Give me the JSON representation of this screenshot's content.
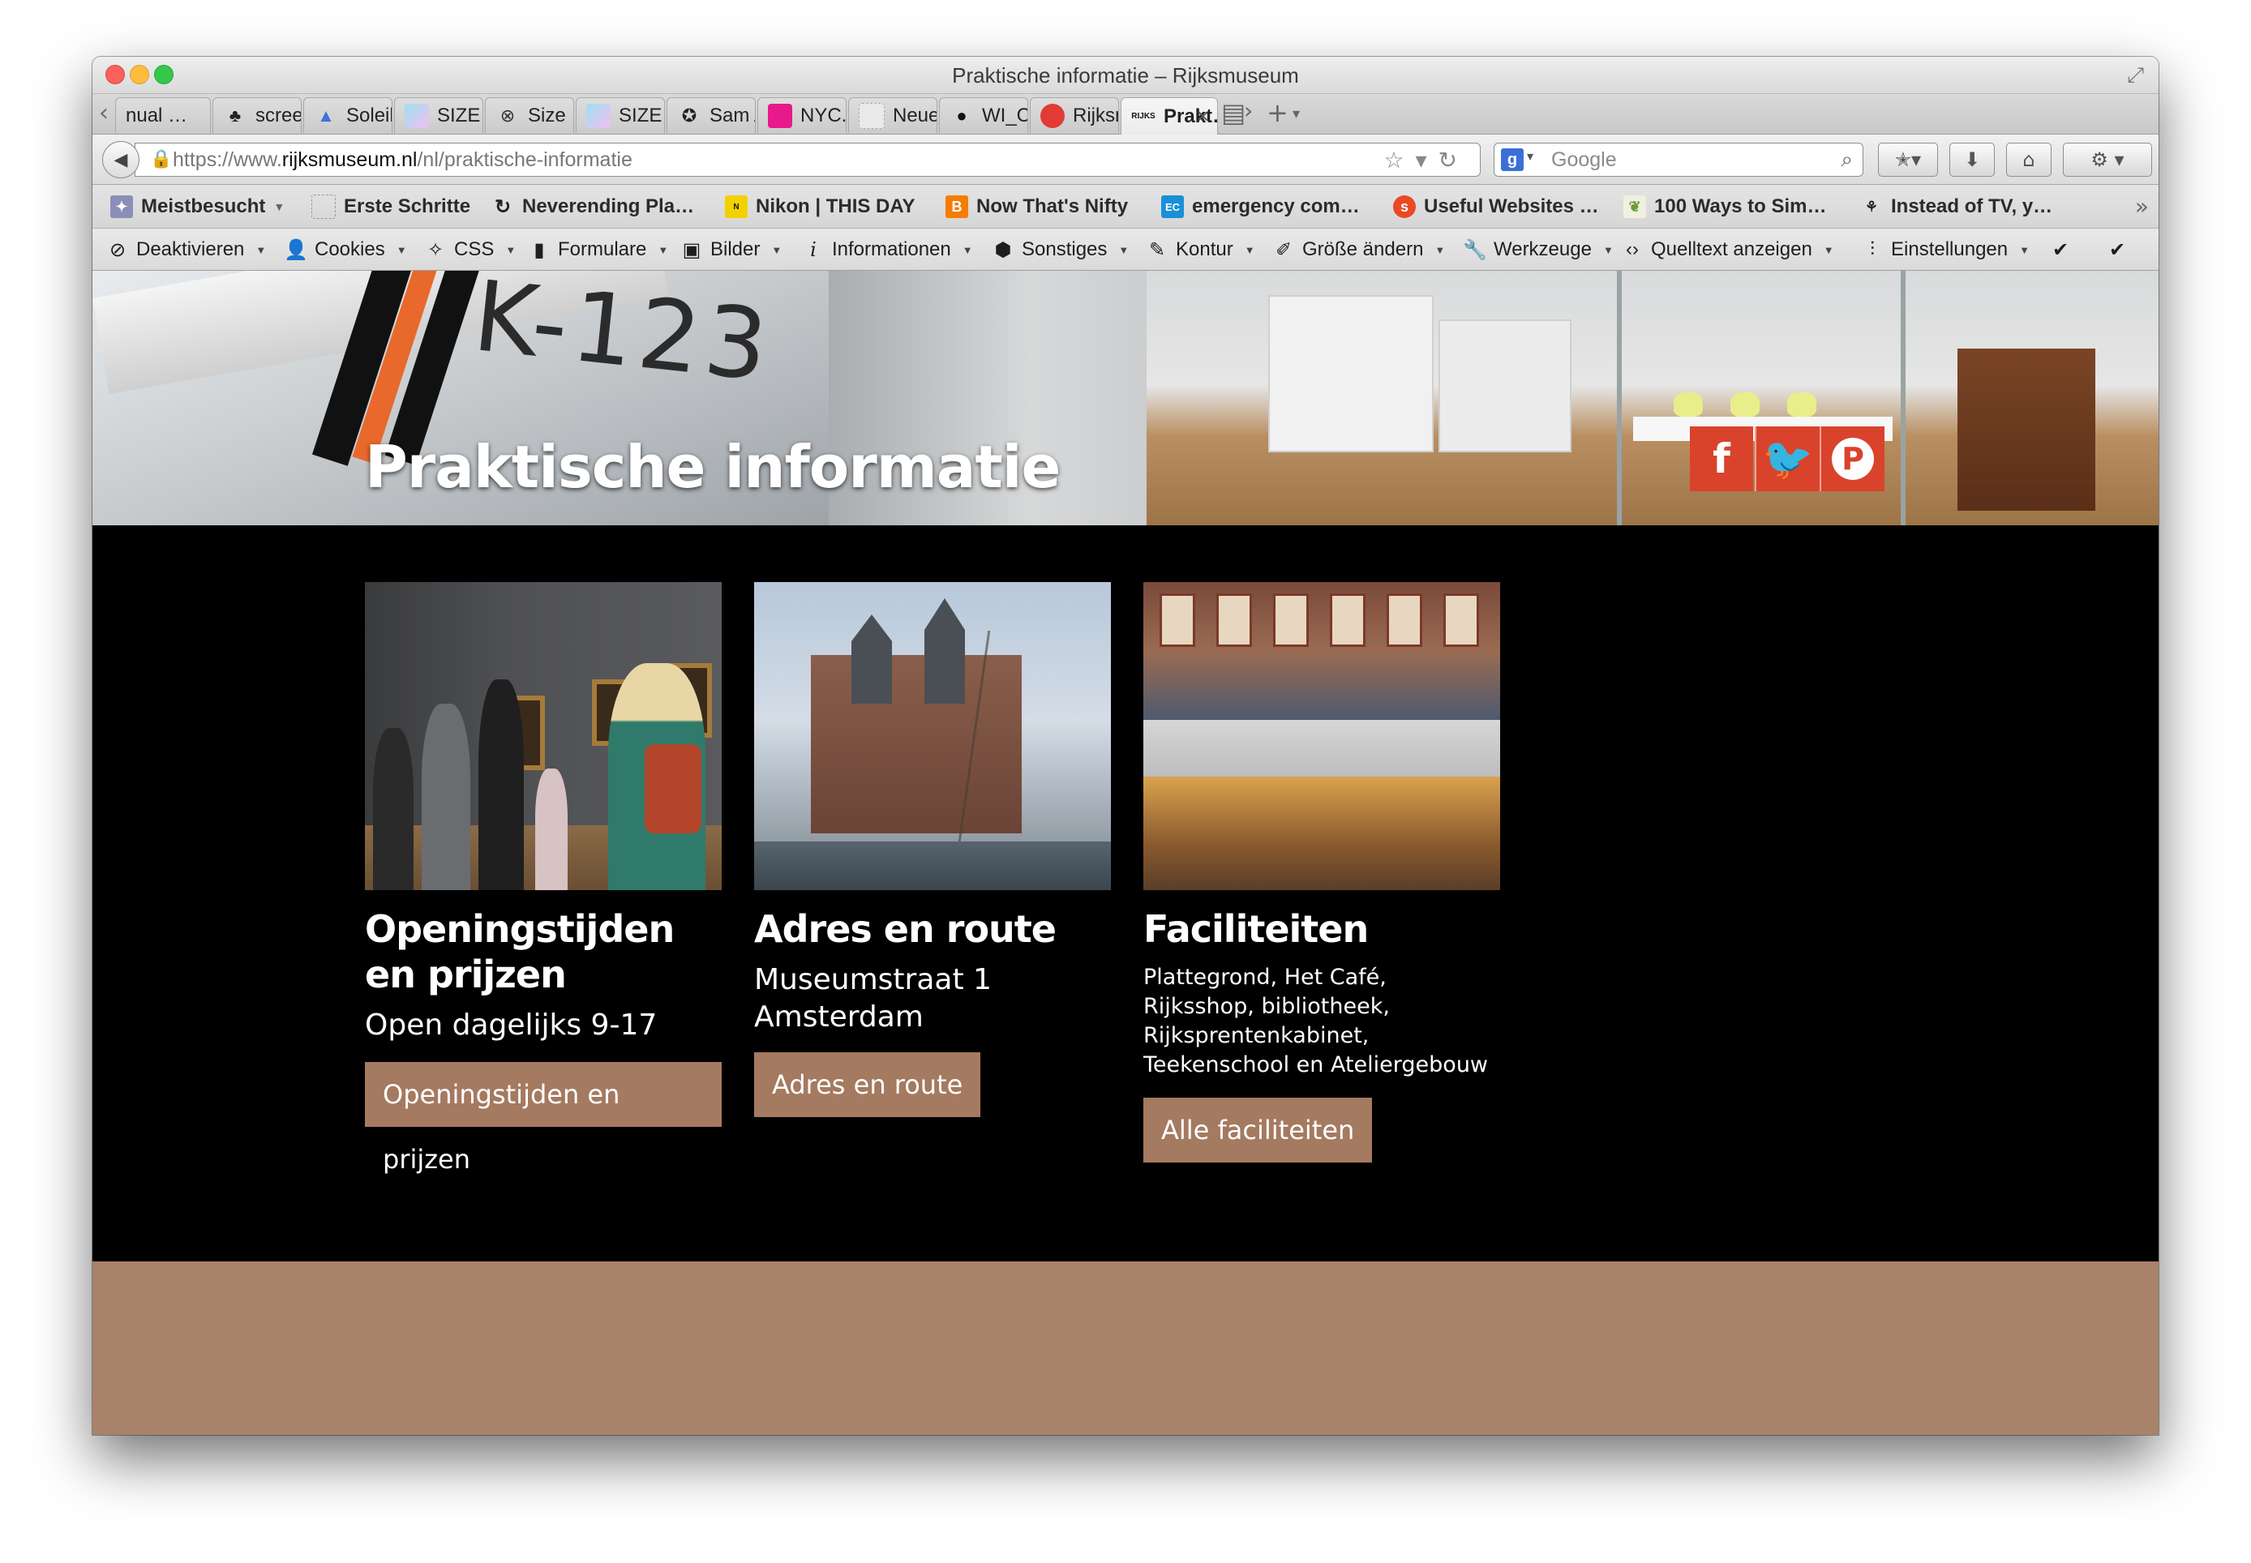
{
  "window": {
    "title": "Praktische informatie – Rijksmuseum"
  },
  "tabs": [
    {
      "label": "nual …",
      "icon": "page-icon"
    },
    {
      "label": "screena…",
      "icon": "tree-icon"
    },
    {
      "label": "Soleil N…",
      "icon": "triangle-icon"
    },
    {
      "label": "SIZE #D…",
      "icon": "gradient-icon"
    },
    {
      "label": "Size",
      "icon": "circle-logo-icon"
    },
    {
      "label": "SIZE #D…",
      "icon": "gradient-icon"
    },
    {
      "label": "Sam Ali…",
      "icon": "badge-icon"
    },
    {
      "label": "NYC.gov…",
      "icon": "pink-square-icon"
    },
    {
      "label": "Neuer Tab",
      "icon": "blank-page-icon"
    },
    {
      "label": "WI_Code…",
      "icon": "github-icon"
    },
    {
      "label": "Rijksmu…",
      "icon": "red-dot-icon"
    },
    {
      "label": "Prakt…",
      "icon": "rijks-logo-icon",
      "active": true,
      "logo_text": "RIJKS"
    }
  ],
  "nav": {
    "url_prefix": "https://www.",
    "url_domain": "rijksmuseum.nl",
    "url_path": "/nl/praktische-informatie",
    "search_placeholder": "Google",
    "search_engine_letter": "g"
  },
  "bookmarks": [
    {
      "label": "Meistbesucht",
      "icon": "folder-icon",
      "dropdown": true
    },
    {
      "label": "Erste Schritte",
      "icon": "blank-page-icon"
    },
    {
      "label": "Neverending Pla…",
      "icon": "spiral-icon"
    },
    {
      "label": "Nikon | THIS DAY",
      "icon": "nikon-icon"
    },
    {
      "label": "Now That's Nifty",
      "icon": "blogger-icon"
    },
    {
      "label": "emergency com…",
      "icon": "ec-icon",
      "icon_text": "EC"
    },
    {
      "label": "Useful Websites …",
      "icon": "stumbleupon-icon"
    },
    {
      "label": "100 Ways to Sim…",
      "icon": "plant-icon"
    },
    {
      "label": "Instead of TV, y…",
      "icon": "bike-icon"
    }
  ],
  "devtools": [
    {
      "label": "Deaktivieren",
      "icon": "disable-icon"
    },
    {
      "label": "Cookies",
      "icon": "person-icon"
    },
    {
      "label": "CSS",
      "icon": "wand-icon"
    },
    {
      "label": "Formulare",
      "icon": "clipboard-icon"
    },
    {
      "label": "Bilder",
      "icon": "image-icon"
    },
    {
      "label": "Informationen",
      "icon": "info-icon"
    },
    {
      "label": "Sonstiges",
      "icon": "box-icon"
    },
    {
      "label": "Kontur",
      "icon": "pencil-icon"
    },
    {
      "label": "Größe ändern",
      "icon": "resize-icon"
    },
    {
      "label": "Werkzeuge",
      "icon": "wrench-icon"
    },
    {
      "label": "Quelltext anzeigen",
      "icon": "code-icon"
    },
    {
      "label": "Einstellungen",
      "icon": "sliders-icon"
    }
  ],
  "hero": {
    "title": "Praktische informatie",
    "plane_registration": "K-123",
    "social": [
      {
        "name": "facebook",
        "glyph": "f"
      },
      {
        "name": "twitter",
        "glyph": "t"
      },
      {
        "name": "pinterest",
        "glyph": "P"
      }
    ]
  },
  "cards": [
    {
      "title": "Openingstijden en prijzen",
      "text": "Open dagelijks 9-17",
      "button": "Openingstijden en prijzen"
    },
    {
      "title": "Adres en route",
      "text": "Museumstraat 1 Amsterdam",
      "button": "Adres en route"
    },
    {
      "title": "Faciliteiten",
      "text": "Plattegrond, Het Café, Rijksshop, bibliotheek, Rijksprentenkabinet, Teekenschool en Ateliergebouw",
      "button": "Alle faciliteiten"
    }
  ],
  "colors": {
    "accent_button": "#a47a60",
    "footer_band": "#a9826a",
    "social": "#d9432b"
  }
}
